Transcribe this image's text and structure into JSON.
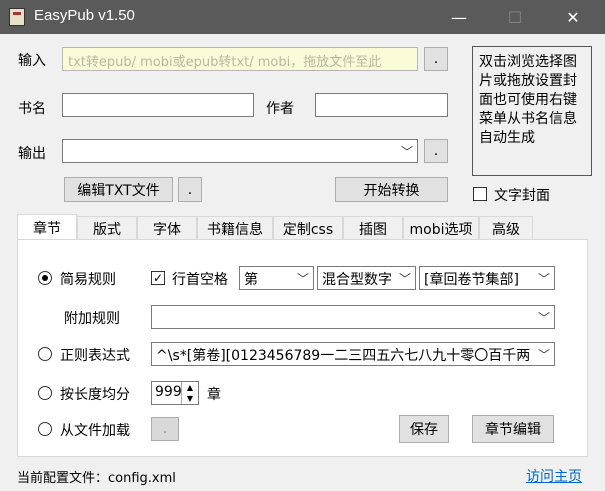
{
  "window": {
    "title": "EasyPub v1.50",
    "minimize": "—",
    "maximize": "☐",
    "close": "✕"
  },
  "form": {
    "input_label": "输入",
    "input_placeholder": "txt转epub/ mobi或epub转txt/ mobi，拖放文件至此",
    "browse": ".",
    "book_label": "书名",
    "author_label": "作者",
    "output_label": "输出",
    "output_browse": ".",
    "edit_txt": "编辑TXT文件",
    "edit_txt_more": ".",
    "start": "开始转换",
    "text_cover": "文字封面"
  },
  "hint": {
    "text": "双击浏览选择图片或拖放设置封面也可使用右键菜单从书名信息自动生成"
  },
  "tabs": [
    {
      "label": "章节",
      "active": true
    },
    {
      "label": "版式"
    },
    {
      "label": "字体"
    },
    {
      "label": "书籍信息"
    },
    {
      "label": "定制css"
    },
    {
      "label": "插图"
    },
    {
      "label": "mobi选项"
    },
    {
      "label": "高级"
    }
  ],
  "chapter": {
    "simple_rule": "简易规则",
    "line_indent": "行首空格",
    "indent_checked": "✓",
    "prefix": "第",
    "numtype": "混合型数字",
    "unit": "[章回卷节集部]",
    "extra_rule": "附加规则",
    "regex": "正则表达式",
    "regex_value": "^\\s*[第卷][0123456789一二三四五六七八九十零〇百千两",
    "by_length": "按长度均分",
    "length_value": "999",
    "length_unit": "章",
    "from_file": "从文件加载",
    "load_btn": ".",
    "save": "保存",
    "edit_chapters": "章节编辑"
  },
  "status": {
    "config": "当前配置文件：config.xml",
    "homepage": "访问主页"
  }
}
